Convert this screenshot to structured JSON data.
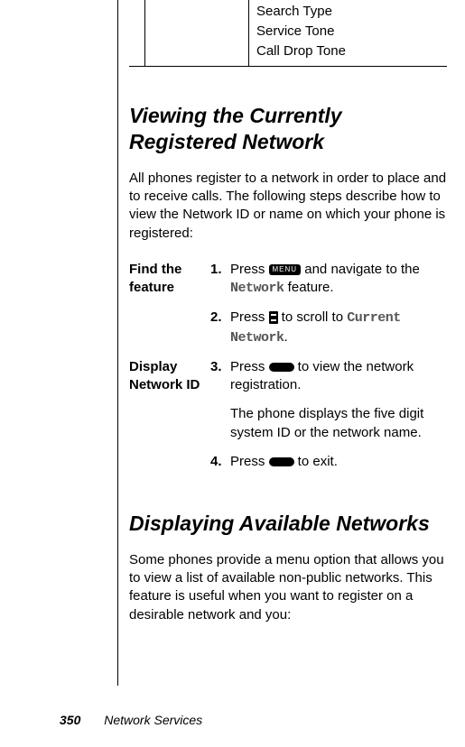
{
  "top_table": {
    "items": [
      "Search Type",
      "Service Tone",
      "Call Drop Tone"
    ]
  },
  "section1": {
    "title": "Viewing the Currently Registered Network",
    "intro": "All phones register to a network in order to place and to receive calls. The following steps describe how to view the Network ID or name on which your phone is registered:",
    "group1_label": "Find the feature",
    "step1": {
      "num": "1.",
      "pre": "Press ",
      "menu_label": "MENU",
      "mid": " and navigate to the ",
      "mono": "Network",
      "post": " feature."
    },
    "step2": {
      "num": "2.",
      "pre": "Press ",
      "mid": " to scroll to ",
      "mono": "Current Network",
      "post": "."
    },
    "group2_label": "Display Network ID",
    "step3": {
      "num": "3.",
      "pre": "Press ",
      "post": " to view the network registration."
    },
    "step3_extra": "The phone displays the five digit system ID or the network name.",
    "step4": {
      "num": "4.",
      "pre": "Press ",
      "post": " to exit."
    }
  },
  "section2": {
    "title": "Displaying Available Networks",
    "intro": "Some phones provide a menu option that allows you to view a list of available non-public networks. This feature is useful when you want to register on a desirable network and you:"
  },
  "footer": {
    "page": "350",
    "section": "Network Services"
  }
}
